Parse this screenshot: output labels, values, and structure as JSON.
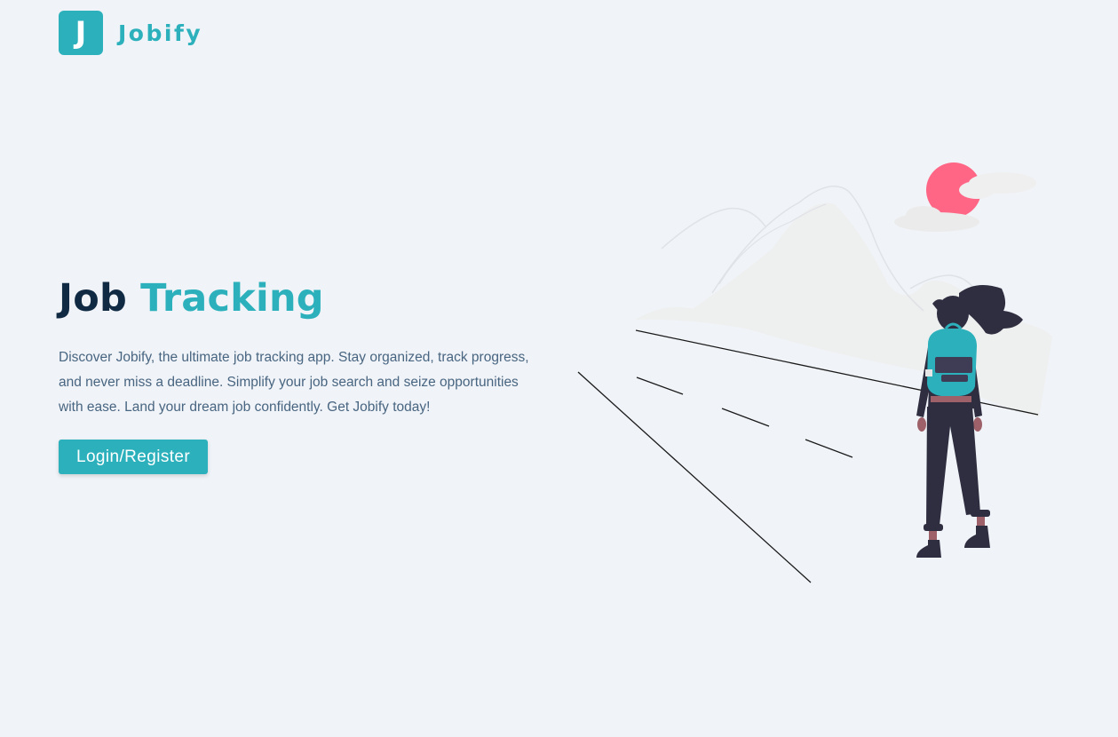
{
  "brand": {
    "logo_letter": "J",
    "name": "Jobify",
    "accent_color": "#2cb1bc"
  },
  "hero": {
    "title_main": "Job",
    "title_accent": "Tracking",
    "description": "Discover Jobify, the ultimate job tracking app. Stay organized, track progress, and never miss a deadline. Simplify your job search and seize opportunities with ease. Land your dream job confidently. Get Jobify today!",
    "button_label": "Login/Register"
  },
  "illustration": {
    "subject": "woman-with-backpack-looking-at-mountains",
    "sun_color": "#ff6584",
    "figure_color": "#2f2e41"
  }
}
